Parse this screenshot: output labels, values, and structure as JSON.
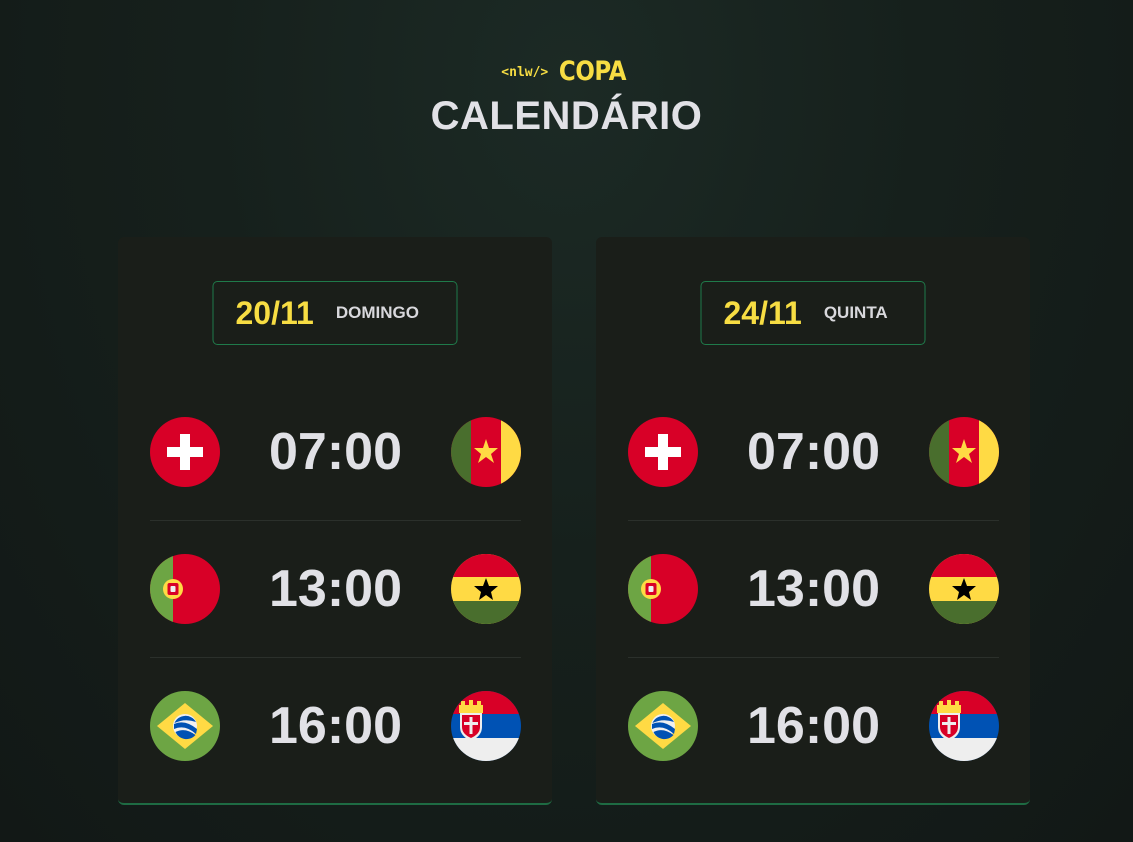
{
  "header": {
    "logo_code": "<nlw/>",
    "logo_brand": "COPA",
    "title": "CALENDÁRIO"
  },
  "colors": {
    "accent_yellow": "#f7dd43",
    "border_green": "#1f7a4a",
    "card_bg": "#1a1e19",
    "text": "#e1e1e6"
  },
  "cards": [
    {
      "date": "20/11",
      "weekday": "DOMINGO",
      "games": [
        {
          "home_flag": "switzerland-flag-icon",
          "time": "07:00",
          "away_flag": "cameroon-flag-icon"
        },
        {
          "home_flag": "portugal-flag-icon",
          "time": "13:00",
          "away_flag": "ghana-flag-icon"
        },
        {
          "home_flag": "brazil-flag-icon",
          "time": "16:00",
          "away_flag": "serbia-flag-icon"
        }
      ]
    },
    {
      "date": "24/11",
      "weekday": "QUINTA",
      "games": [
        {
          "home_flag": "switzerland-flag-icon",
          "time": "07:00",
          "away_flag": "cameroon-flag-icon"
        },
        {
          "home_flag": "portugal-flag-icon",
          "time": "13:00",
          "away_flag": "ghana-flag-icon"
        },
        {
          "home_flag": "brazil-flag-icon",
          "time": "16:00",
          "away_flag": "serbia-flag-icon"
        }
      ]
    }
  ]
}
